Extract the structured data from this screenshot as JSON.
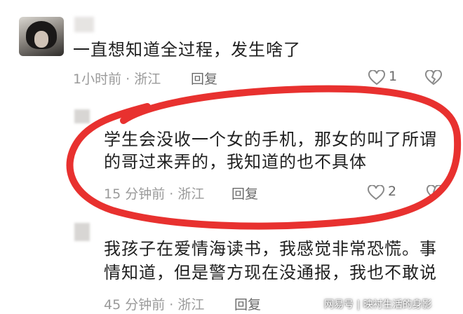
{
  "comments": [
    {
      "text_lines": [
        "一直想知道全过程，发生啥了"
      ],
      "time": "1小时前",
      "sep": "·",
      "location": "浙江",
      "reply_label": "回复",
      "likes": "1"
    },
    {
      "text_lines": [
        "学生会没收一个女的手机，那女的叫了所谓",
        "的哥过来弄的，我知道的也不具体"
      ],
      "time": "15 分钟前",
      "sep": "·",
      "location": "浙江",
      "reply_label": "回复",
      "likes": "2"
    },
    {
      "text_lines": [
        "我孩子在爱情海读书，我感觉非常恐慌。事",
        "情知道，但是警方现在没通报，我也不敢说"
      ],
      "time": "45 分钟前",
      "sep": "·",
      "location": "浙江",
      "reply_label": "回复"
    }
  ],
  "watermark": "网易号 | 映衬生活的身影",
  "colors": {
    "highlight": "#e8312f",
    "icon": "#8a8a8a"
  },
  "icons": [
    "heart-icon",
    "broken-heart-icon"
  ]
}
